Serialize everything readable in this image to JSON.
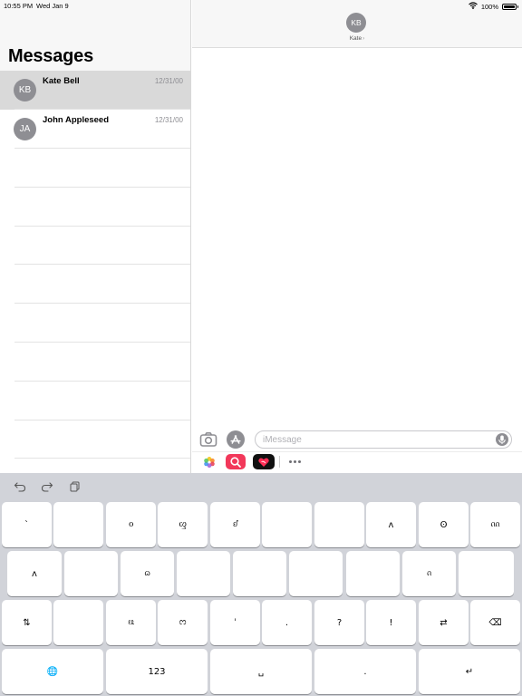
{
  "status_bar": {
    "time": "10:55 PM",
    "date": "Wed Jan 9",
    "battery_text": "100%",
    "battery_level": 1.0,
    "icons": [
      "wifi-icon",
      "battery-icon"
    ]
  },
  "sidebar": {
    "title": "Messages",
    "conversations": [
      {
        "initials": "KB",
        "name": "Kate Bell",
        "date": "12/31/00",
        "selected": true
      },
      {
        "initials": "JA",
        "name": "John Appleseed",
        "date": "12/31/00",
        "selected": false
      }
    ]
  },
  "conversation": {
    "contact_initials": "KB",
    "contact_name": "Kate",
    "input_placeholder": "iMessage",
    "input_value": "",
    "icons": [
      "camera-icon",
      "app-store-icon",
      "microphone-icon",
      "photos-app-icon",
      "image-search-app-icon",
      "digital-touch-app-icon",
      "more-apps-icon"
    ]
  },
  "keyboard": {
    "toolbar_icons": [
      "undo-icon",
      "redo-icon",
      "paste-icon"
    ],
    "rows": [
      [
        "ˋ",
        "",
        "ᦞ",
        "ᦐ",
        "ᦊ",
        "",
        "",
        "ᴧ",
        "ʘ",
        "ᦶ"
      ],
      [
        "ᴧ",
        "",
        "ᦒ",
        "",
        "",
        "",
        "",
        "ᦵ",
        ""
      ],
      [
        "⇅",
        "",
        "ᦕ",
        "ᦂ",
        "ˈ",
        ".",
        "?",
        "!",
        "⇄",
        "⌫"
      ],
      [
        "🌐",
        "123",
        "␣",
        ".",
        "↵"
      ]
    ],
    "colors": {
      "background": "#d1d3d9",
      "key": "#ffffff"
    }
  },
  "colors": {
    "avatar": "#8e8e93",
    "selected_row": "#d9d9d9",
    "header_bg": "#f7f7f7",
    "photos_icon": "#ffffff",
    "image_search_icon": "#f2385a",
    "digital_touch_icon": "#111111"
  }
}
